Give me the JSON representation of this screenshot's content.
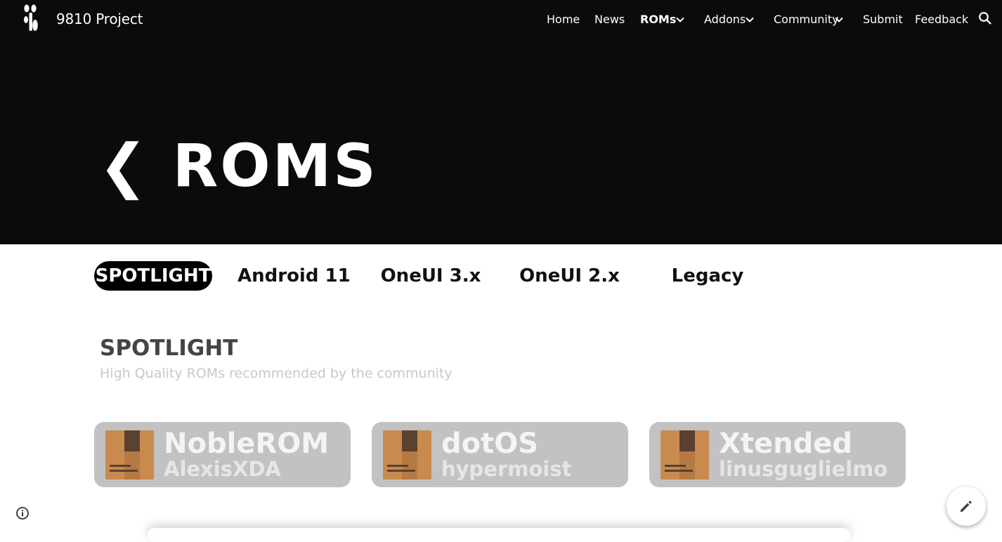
{
  "header": {
    "site_title": "9810 Project",
    "logo_icon": "site-logo-icon",
    "search_icon": "search-icon",
    "nav": {
      "home": "Home",
      "news": "News",
      "roms": "ROMs",
      "addons": "Addons",
      "community": "Community",
      "submit": "Submit",
      "feedback": "Feedback"
    }
  },
  "hero": {
    "title": "❮ ROMS"
  },
  "tabs": {
    "spotlight": "SPOTLIGHT",
    "android11": "Android 11",
    "oneui3": "OneUI 3.x",
    "oneui2": "OneUI 2.x",
    "legacy": "Legacy"
  },
  "section": {
    "title": "SPOTLIGHT",
    "subtitle": "High Quality ROMs recommended by the community"
  },
  "cards": [
    {
      "name": "NobleROM",
      "author": "AlexisXDA",
      "icon": "package-icon"
    },
    {
      "name": "dotOS",
      "author": "hypermoist",
      "icon": "package-icon"
    },
    {
      "name": "Xtended",
      "author": "linusguglielmo",
      "icon": "package-icon"
    }
  ],
  "colors": {
    "hero_bg": "#0b0b0c",
    "card_bg": "#c2c2c2",
    "package": "#c98a4f"
  }
}
